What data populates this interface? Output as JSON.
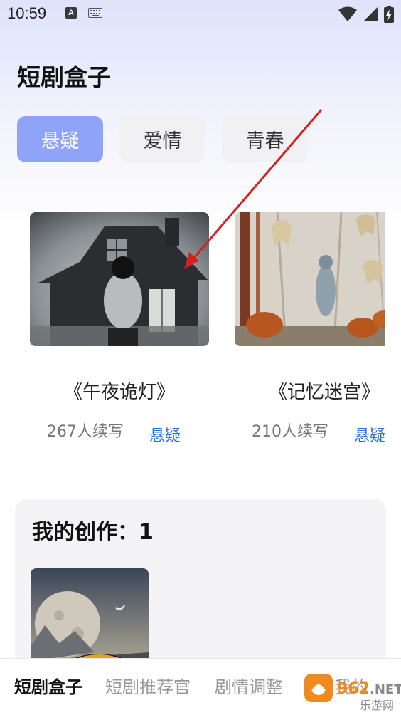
{
  "status_bar": {
    "time": "10:59",
    "badge": "A"
  },
  "app": {
    "title": "短剧盒子"
  },
  "tabs": [
    {
      "label": "悬疑",
      "active": true
    },
    {
      "label": "爱情",
      "active": false
    },
    {
      "label": "青春",
      "active": false
    }
  ],
  "stories": [
    {
      "title": "《午夜诡灯》",
      "count": "267人续写",
      "genre": "悬疑"
    },
    {
      "title": "《记忆迷宫》",
      "count": "210人续写",
      "genre": "悬疑"
    }
  ],
  "my_creations": {
    "heading": "我的创作：1"
  },
  "bottom_nav": [
    {
      "label": "短剧盒子",
      "active": true
    },
    {
      "label": "短剧推荐官",
      "active": false
    },
    {
      "label": "剧情调整",
      "active": false
    },
    {
      "label": "我的",
      "active": false
    }
  ],
  "watermark": {
    "brand": "962.NET",
    "sub": "乐游网"
  },
  "colors": {
    "accent_tab": "#8fa3f8",
    "genre_link": "#2f6fd0",
    "annotation_arrow": "#d42020"
  }
}
